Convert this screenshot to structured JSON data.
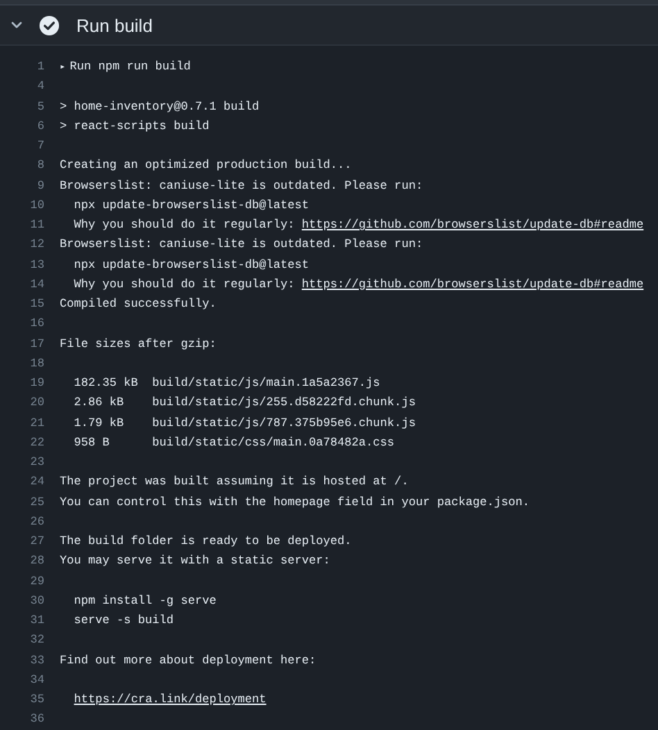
{
  "step": {
    "title": "Run build",
    "expanded": true,
    "passed": true
  },
  "log": [
    {
      "number": "1",
      "marker": "▸",
      "text": "Run npm run build"
    },
    {
      "number": "4"
    },
    {
      "number": "5",
      "text": "> home-inventory@0.7.1 build"
    },
    {
      "number": "6",
      "text": "> react-scripts build"
    },
    {
      "number": "7"
    },
    {
      "number": "8",
      "text": "Creating an optimized production build..."
    },
    {
      "number": "9",
      "text": "Browserslist: caniuse-lite is outdated. Please run:"
    },
    {
      "number": "10",
      "text": "  npx update-browserslist-db@latest"
    },
    {
      "number": "11",
      "text": "  Why you should do it regularly: ",
      "link": "https://github.com/browserslist/update-db#readme"
    },
    {
      "number": "12",
      "text": "Browserslist: caniuse-lite is outdated. Please run:"
    },
    {
      "number": "13",
      "text": "  npx update-browserslist-db@latest"
    },
    {
      "number": "14",
      "text": "  Why you should do it regularly: ",
      "link": "https://github.com/browserslist/update-db#readme"
    },
    {
      "number": "15",
      "text": "Compiled successfully."
    },
    {
      "number": "16"
    },
    {
      "number": "17",
      "text": "File sizes after gzip:"
    },
    {
      "number": "18"
    },
    {
      "number": "19",
      "text": "  182.35 kB  build/static/js/main.1a5a2367.js"
    },
    {
      "number": "20",
      "text": "  2.86 kB    build/static/js/255.d58222fd.chunk.js"
    },
    {
      "number": "21",
      "text": "  1.79 kB    build/static/js/787.375b95e6.chunk.js"
    },
    {
      "number": "22",
      "text": "  958 B      build/static/css/main.0a78482a.css"
    },
    {
      "number": "23"
    },
    {
      "number": "24",
      "text": "The project was built assuming it is hosted at /."
    },
    {
      "number": "25",
      "text": "You can control this with the homepage field in your package.json."
    },
    {
      "number": "26"
    },
    {
      "number": "27",
      "text": "The build folder is ready to be deployed."
    },
    {
      "number": "28",
      "text": "You may serve it with a static server:"
    },
    {
      "number": "29"
    },
    {
      "number": "30",
      "text": "  npm install -g serve"
    },
    {
      "number": "31",
      "text": "  serve -s build"
    },
    {
      "number": "32"
    },
    {
      "number": "33",
      "text": "Find out more about deployment here:"
    },
    {
      "number": "34"
    },
    {
      "number": "35",
      "indented": true,
      "link": "https://cra.link/deployment"
    },
    {
      "number": "36"
    }
  ]
}
